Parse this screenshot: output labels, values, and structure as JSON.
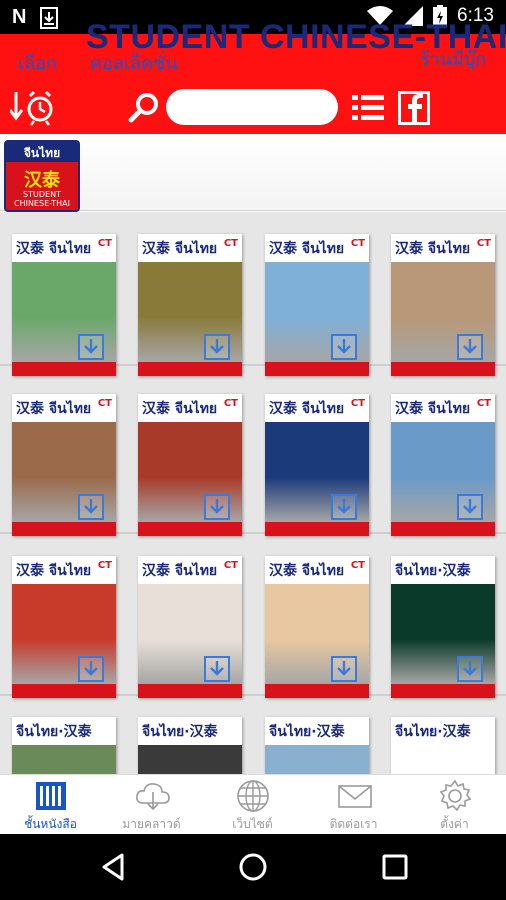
{
  "status_bar": {
    "left_icons": [
      "n-icon",
      "download-icon"
    ],
    "time": "6:13",
    "right_icons": [
      "wifi-icon",
      "signal-icon",
      "battery-icon"
    ]
  },
  "header": {
    "menu_select": "เลือก",
    "menu_collection": "คอลเล็คชั่น",
    "menu_bookstore": "ร้านมีบุ๊ก",
    "search_placeholder": "",
    "colors": {
      "red": "#ff1111",
      "blue": "#1a55c8"
    }
  },
  "banner": {
    "title": "STUDENT CHINESE-THAI",
    "logo_top": "จีนไทย",
    "logo_zh": "汉泰",
    "logo_sub": "STUDENT CHINESE-THAI"
  },
  "covers": [
    {
      "mast": "汉泰 จีนไทย",
      "ct": "CT",
      "art": "#6aa86a"
    },
    {
      "mast": "汉泰 จีนไทย",
      "ct": "CT",
      "art": "#8a7a3a"
    },
    {
      "mast": "汉泰 จีนไทย",
      "ct": "CT",
      "art": "#7fb0d8"
    },
    {
      "mast": "汉泰 จีนไทย",
      "ct": "CT",
      "art": "#b89878"
    },
    {
      "mast": "汉泰 จีนไทย",
      "ct": "CT",
      "art": "#9a6a4a"
    },
    {
      "mast": "汉泰 จีนไทย",
      "ct": "CT",
      "art": "#a83a2a"
    },
    {
      "mast": "汉泰 จีนไทย",
      "ct": "CT",
      "art": "#1a3a7a"
    },
    {
      "mast": "汉泰 จีนไทย",
      "ct": "CT",
      "art": "#6a9ac8"
    },
    {
      "mast": "汉泰 จีนไทย",
      "ct": "CT",
      "art": "#c83a2a"
    },
    {
      "mast": "汉泰 จีนไทย",
      "ct": "CT",
      "art": "#e8e0d8"
    },
    {
      "mast": "汉泰 จีนไทย",
      "ct": "CT",
      "art": "#e8c8a0"
    },
    {
      "mast": "จีนไทย·汉泰",
      "ct": "",
      "art": "#0a3a2a"
    },
    {
      "mast": "จีนไทย·汉泰",
      "ct": "",
      "art": "#6a8a5a"
    },
    {
      "mast": "จีนไทย·汉泰",
      "ct": "",
      "art": "#3a3a3a"
    },
    {
      "mast": "จีนไทย·汉泰",
      "ct": "",
      "art": "#8ab0d0"
    },
    {
      "mast": "จีนไทย·汉泰",
      "ct": "",
      "art": "#ffffff"
    }
  ],
  "tabs": [
    {
      "label": "ชั้นหนังสือ",
      "icon": "bookshelf-icon",
      "active": true
    },
    {
      "label": "มายคลาวด์",
      "icon": "cloud-icon",
      "active": false
    },
    {
      "label": "เว็บไซต์",
      "icon": "globe-icon",
      "active": false
    },
    {
      "label": "ติดต่อเรา",
      "icon": "mail-icon",
      "active": false
    },
    {
      "label": "ตั้งค่า",
      "icon": "gear-icon",
      "active": false
    }
  ]
}
